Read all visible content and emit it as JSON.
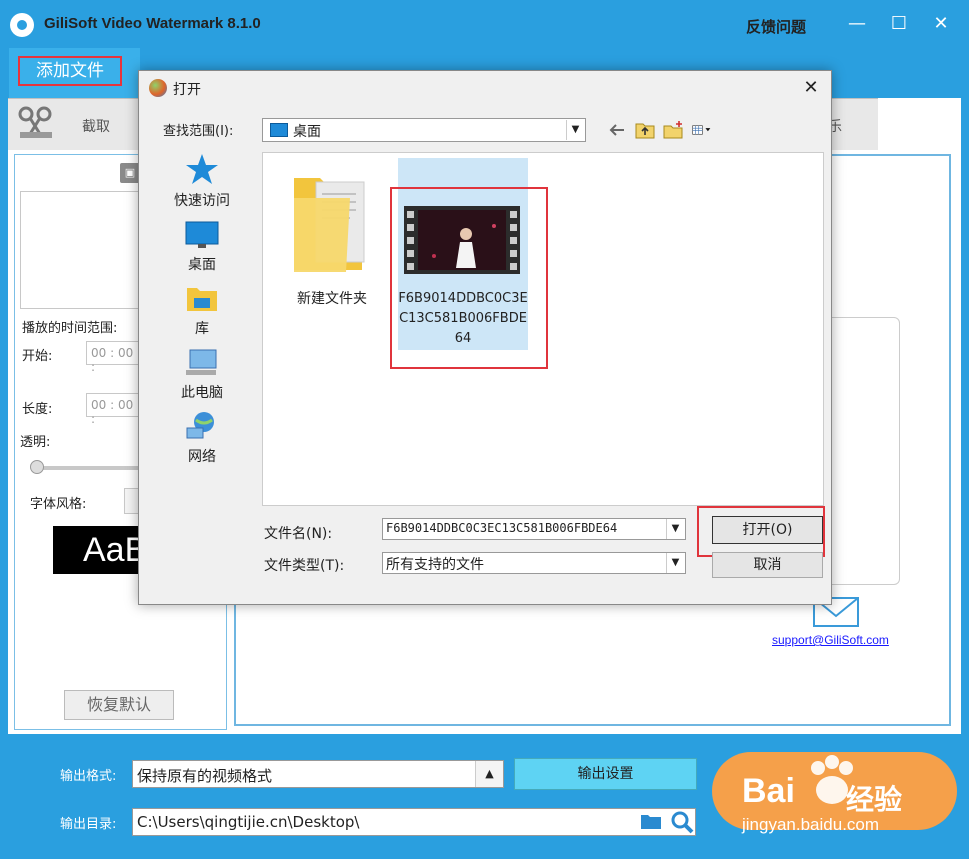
{
  "window": {
    "title": "GiliSoft Video Watermark 8.1.0",
    "feedback": "反馈问题"
  },
  "tabs": {
    "add_file": "添加文件",
    "clip": "截取",
    "music": "乐"
  },
  "left_panel": {
    "play_range": "播放的时间范围:",
    "start_label": "开始:",
    "start_value": "00 : 00 :",
    "length_label": "长度:",
    "length_value": "00 : 00 :",
    "opacity_label": "透明:",
    "font_style_label": "字体风格:",
    "font_sample": "AaB",
    "reset_button": "恢复默认"
  },
  "support": {
    "email": "support@GiliSoft.com"
  },
  "bottom": {
    "output_format_label": "输出格式:",
    "output_format_value": "保持原有的视频格式",
    "output_settings": "输出设置",
    "output_dir_label": "输出目录:",
    "output_dir_value": "C:\\Users\\qingtijie.cn\\Desktop\\"
  },
  "dialog": {
    "title": "打开",
    "look_in_label": "查找范围(I):",
    "look_in_value": "桌面",
    "places": [
      "快速访问",
      "桌面",
      "库",
      "此电脑",
      "网络"
    ],
    "files": [
      {
        "name": "新建文件夹",
        "type": "folder"
      },
      {
        "name": "F6B9014DDBC0C3EC13C581B006FBDE64",
        "type": "video",
        "selected": true
      }
    ],
    "filename_label": "文件名(N):",
    "filename_value": "F6B9014DDBC0C3EC13C581B006FBDE64",
    "filetype_label": "文件类型(T):",
    "filetype_value": "所有支持的文件",
    "open_button": "打开(O)",
    "cancel_button": "取消"
  },
  "watermark": {
    "brand": "Bai",
    "brand_suffix": "经验",
    "url": "jingyan.baidu.com"
  },
  "colors": {
    "titlebar": "#2a9fdf",
    "highlight_red": "#e0343c",
    "selection": "#cde6f7",
    "start_button": "#f5a04a"
  }
}
